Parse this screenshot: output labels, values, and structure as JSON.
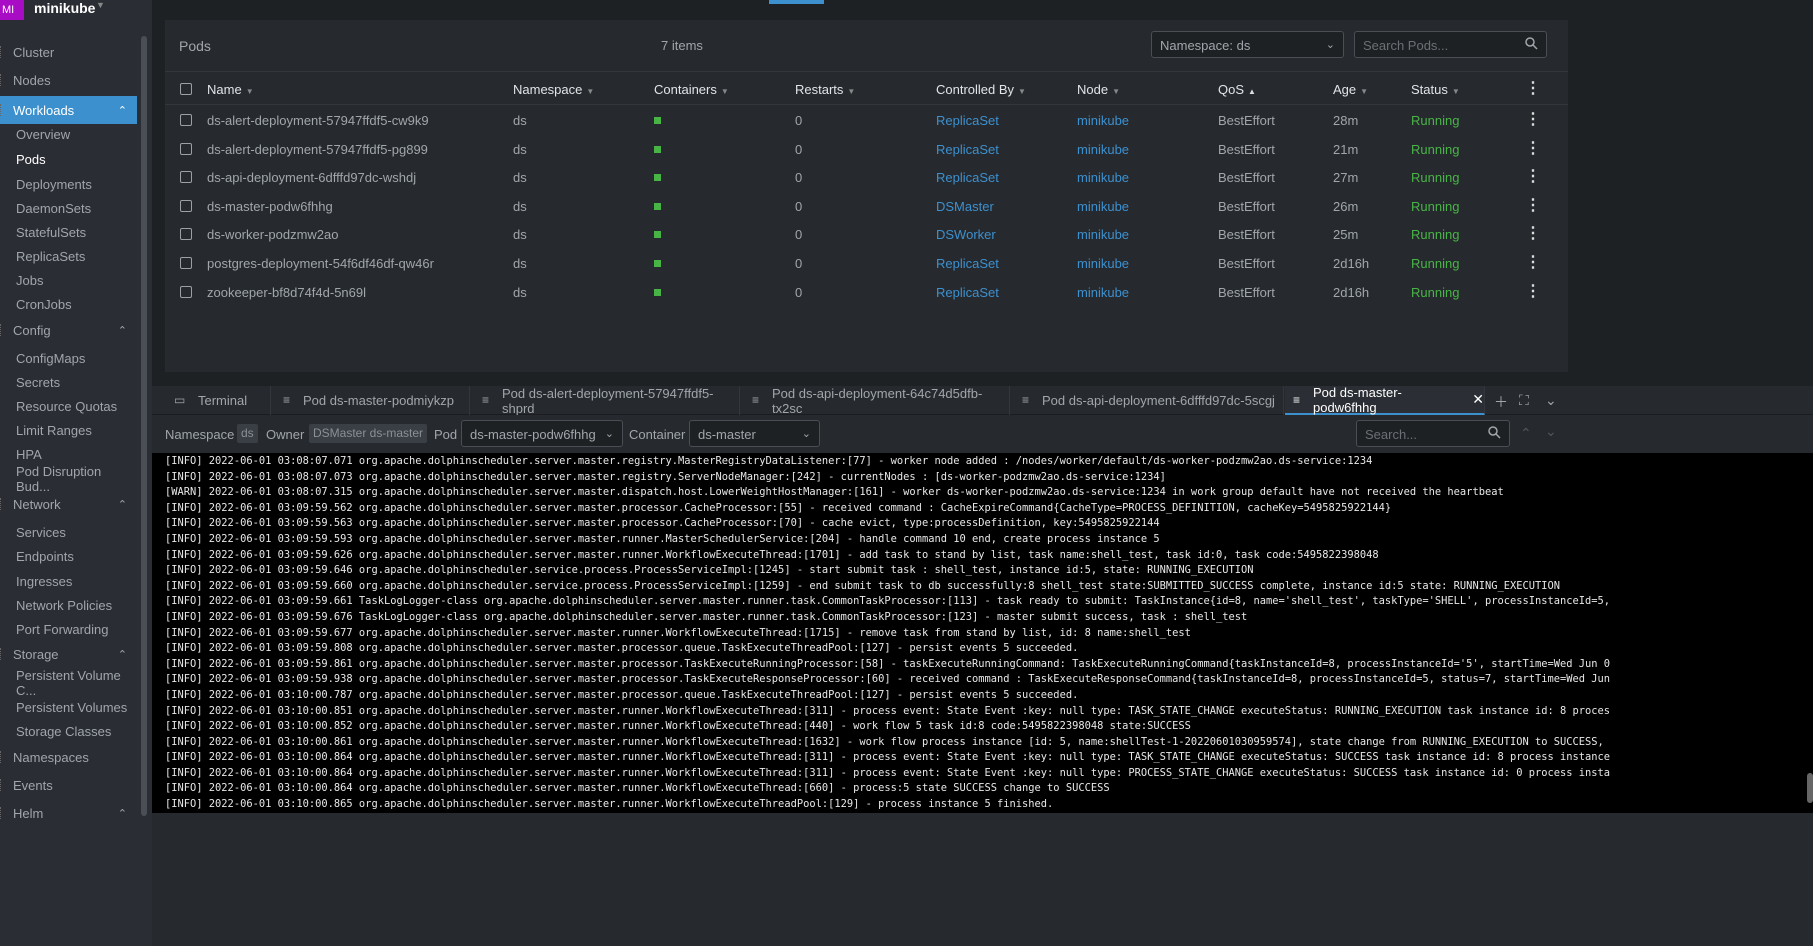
{
  "cluster": {
    "badge": "MI",
    "name": "minikube"
  },
  "sidebar": {
    "items": [
      {
        "label": "Cluster",
        "type": "top"
      },
      {
        "label": "Nodes",
        "type": "top"
      },
      {
        "label": "Workloads",
        "type": "top-active"
      },
      {
        "label": "Overview",
        "type": "sub"
      },
      {
        "label": "Pods",
        "type": "sub-active"
      },
      {
        "label": "Deployments",
        "type": "sub"
      },
      {
        "label": "DaemonSets",
        "type": "sub"
      },
      {
        "label": "StatefulSets",
        "type": "sub"
      },
      {
        "label": "ReplicaSets",
        "type": "sub"
      },
      {
        "label": "Jobs",
        "type": "sub"
      },
      {
        "label": "CronJobs",
        "type": "sub"
      },
      {
        "label": "Config",
        "type": "top-group"
      },
      {
        "label": "ConfigMaps",
        "type": "sub"
      },
      {
        "label": "Secrets",
        "type": "sub"
      },
      {
        "label": "Resource Quotas",
        "type": "sub"
      },
      {
        "label": "Limit Ranges",
        "type": "sub"
      },
      {
        "label": "HPA",
        "type": "sub"
      },
      {
        "label": "Pod Disruption Bud...",
        "type": "sub"
      },
      {
        "label": "Network",
        "type": "top-group"
      },
      {
        "label": "Services",
        "type": "sub"
      },
      {
        "label": "Endpoints",
        "type": "sub"
      },
      {
        "label": "Ingresses",
        "type": "sub"
      },
      {
        "label": "Network Policies",
        "type": "sub"
      },
      {
        "label": "Port Forwarding",
        "type": "sub"
      },
      {
        "label": "Storage",
        "type": "top-group"
      },
      {
        "label": "Persistent Volume C...",
        "type": "sub"
      },
      {
        "label": "Persistent Volumes",
        "type": "sub"
      },
      {
        "label": "Storage Classes",
        "type": "sub"
      },
      {
        "label": "Namespaces",
        "type": "top"
      },
      {
        "label": "Events",
        "type": "top"
      },
      {
        "label": "Helm",
        "type": "top-group"
      }
    ]
  },
  "pods": {
    "title": "Pods",
    "count": "7 items",
    "namespace_select": "Namespace: ds",
    "search_placeholder": "Search Pods...",
    "columns": [
      "Name",
      "Namespace",
      "Containers",
      "Restarts",
      "Controlled By",
      "Node",
      "QoS",
      "Age",
      "Status"
    ],
    "rows": [
      {
        "name": "ds-alert-deployment-57947ffdf5-cw9k9",
        "namespace": "ds",
        "restarts": "0",
        "controlled_by": "ReplicaSet",
        "node": "minikube",
        "qos": "BestEffort",
        "age": "28m",
        "status": "Running"
      },
      {
        "name": "ds-alert-deployment-57947ffdf5-pg899",
        "namespace": "ds",
        "restarts": "0",
        "controlled_by": "ReplicaSet",
        "node": "minikube",
        "qos": "BestEffort",
        "age": "21m",
        "status": "Running"
      },
      {
        "name": "ds-api-deployment-6dfffd97dc-wshdj",
        "namespace": "ds",
        "restarts": "0",
        "controlled_by": "ReplicaSet",
        "node": "minikube",
        "qos": "BestEffort",
        "age": "27m",
        "status": "Running"
      },
      {
        "name": "ds-master-podw6fhhg",
        "namespace": "ds",
        "restarts": "0",
        "controlled_by": "DSMaster",
        "node": "minikube",
        "qos": "BestEffort",
        "age": "26m",
        "status": "Running"
      },
      {
        "name": "ds-worker-podzmw2ao",
        "namespace": "ds",
        "restarts": "0",
        "controlled_by": "DSWorker",
        "node": "minikube",
        "qos": "BestEffort",
        "age": "25m",
        "status": "Running"
      },
      {
        "name": "postgres-deployment-54f6df46df-qw46r",
        "namespace": "ds",
        "restarts": "0",
        "controlled_by": "ReplicaSet",
        "node": "minikube",
        "qos": "BestEffort",
        "age": "2d16h",
        "status": "Running"
      },
      {
        "name": "zookeeper-bf8d74f4d-5n69l",
        "namespace": "ds",
        "restarts": "0",
        "controlled_by": "ReplicaSet",
        "node": "minikube",
        "qos": "BestEffort",
        "age": "2d16h",
        "status": "Running"
      }
    ]
  },
  "dock": {
    "tabs": [
      {
        "label": "Terminal",
        "icon": "terminal-icon"
      },
      {
        "label": "Pod ds-master-podmiykzp",
        "icon": "log-icon"
      },
      {
        "label": "Pod ds-alert-deployment-57947ffdf5-shprd",
        "icon": "log-icon"
      },
      {
        "label": "Pod ds-api-deployment-64c74d5dfb-tx2sc",
        "icon": "log-icon"
      },
      {
        "label": "Pod ds-api-deployment-6dfffd97dc-5scgj",
        "icon": "log-icon"
      },
      {
        "label": "Pod ds-master-podw6fhhg",
        "icon": "log-icon",
        "active": true
      }
    ],
    "namespace_label": "Namespace",
    "namespace_value": "ds",
    "owner_label": "Owner",
    "owner_value": "DSMaster ds-master",
    "pod_label": "Pod",
    "pod_select": "ds-master-podw6fhhg",
    "container_label": "Container",
    "container_select": "ds-master",
    "search_placeholder": "Search..."
  },
  "logs": [
    "[INFO] 2022-06-01 03:08:07.071 org.apache.dolphinscheduler.server.master.registry.MasterRegistryDataListener:[77] - worker node added : /nodes/worker/default/ds-worker-podzmw2ao.ds-service:1234",
    "[INFO] 2022-06-01 03:08:07.073 org.apache.dolphinscheduler.server.master.registry.ServerNodeManager:[242] - currentNodes : [ds-worker-podzmw2ao.ds-service:1234]",
    "[WARN] 2022-06-01 03:08:07.315 org.apache.dolphinscheduler.server.master.dispatch.host.LowerWeightHostManager:[161] - worker ds-worker-podzmw2ao.ds-service:1234 in work group default have not received the heartbeat",
    "[INFO] 2022-06-01 03:09:59.562 org.apache.dolphinscheduler.server.master.processor.CacheProcessor:[55] - received command : CacheExpireCommand{CacheType=PROCESS_DEFINITION, cacheKey=5495825922144}",
    "[INFO] 2022-06-01 03:09:59.563 org.apache.dolphinscheduler.server.master.processor.CacheProcessor:[70] - cache evict, type:processDefinition, key:5495825922144",
    "[INFO] 2022-06-01 03:09:59.593 org.apache.dolphinscheduler.server.master.runner.MasterSchedulerService:[204] - handle command 10 end, create process instance 5",
    "[INFO] 2022-06-01 03:09:59.626 org.apache.dolphinscheduler.server.master.runner.WorkflowExecuteThread:[1701] - add task to stand by list, task name:shell_test, task id:0, task code:5495822398048",
    "[INFO] 2022-06-01 03:09:59.646 org.apache.dolphinscheduler.service.process.ProcessServiceImpl:[1245] - start submit task : shell_test, instance id:5, state: RUNNING_EXECUTION",
    "[INFO] 2022-06-01 03:09:59.660 org.apache.dolphinscheduler.service.process.ProcessServiceImpl:[1259] - end submit task to db successfully:8 shell_test state:SUBMITTED_SUCCESS complete, instance id:5 state: RUNNING_EXECUTION",
    "[INFO] 2022-06-01 03:09:59.661 TaskLogLogger-class org.apache.dolphinscheduler.server.master.runner.task.CommonTaskProcessor:[113] - task ready to submit: TaskInstance{id=8, name='shell_test', taskType='SHELL', processInstanceId=5,",
    "[INFO] 2022-06-01 03:09:59.676 TaskLogLogger-class org.apache.dolphinscheduler.server.master.runner.task.CommonTaskProcessor:[123] - master submit success, task : shell_test",
    "[INFO] 2022-06-01 03:09:59.677 org.apache.dolphinscheduler.server.master.runner.WorkflowExecuteThread:[1715] - remove task from stand by list, id: 8 name:shell_test",
    "[INFO] 2022-06-01 03:09:59.808 org.apache.dolphinscheduler.server.master.processor.queue.TaskExecuteThreadPool:[127] - persist events 5 succeeded.",
    "[INFO] 2022-06-01 03:09:59.861 org.apache.dolphinscheduler.server.master.processor.TaskExecuteRunningProcessor:[58] - taskExecuteRunningCommand: TaskExecuteRunningCommand{taskInstanceId=8, processInstanceId='5', startTime=Wed Jun 0",
    "[INFO] 2022-06-01 03:09:59.938 org.apache.dolphinscheduler.server.master.processor.TaskExecuteResponseProcessor:[60] - received command : TaskExecuteResponseCommand{taskInstanceId=8, processInstanceId=5, status=7, startTime=Wed Jun",
    "[INFO] 2022-06-01 03:10:00.787 org.apache.dolphinscheduler.server.master.processor.queue.TaskExecuteThreadPool:[127] - persist events 5 succeeded.",
    "[INFO] 2022-06-01 03:10:00.851 org.apache.dolphinscheduler.server.master.runner.WorkflowExecuteThread:[311] - process event: State Event :key: null type: TASK_STATE_CHANGE executeStatus: RUNNING_EXECUTION task instance id: 8 proces",
    "[INFO] 2022-06-01 03:10:00.852 org.apache.dolphinscheduler.server.master.runner.WorkflowExecuteThread:[440] - work flow 5 task id:8 code:5495822398048 state:SUCCESS",
    "[INFO] 2022-06-01 03:10:00.861 org.apache.dolphinscheduler.server.master.runner.WorkflowExecuteThread:[1632] - work flow process instance [id: 5, name:shellTest-1-20220601030959574], state change from RUNNING_EXECUTION to SUCCESS,",
    "[INFO] 2022-06-01 03:10:00.864 org.apache.dolphinscheduler.server.master.runner.WorkflowExecuteThread:[311] - process event: State Event :key: null type: TASK_STATE_CHANGE executeStatus: SUCCESS task instance id: 8 process instance",
    "[INFO] 2022-06-01 03:10:00.864 org.apache.dolphinscheduler.server.master.runner.WorkflowExecuteThread:[311] - process event: State Event :key: null type: PROCESS_STATE_CHANGE executeStatus: SUCCESS task instance id: 0 process insta",
    "[INFO] 2022-06-01 03:10:00.864 org.apache.dolphinscheduler.server.master.runner.WorkflowExecuteThread:[660] - process:5 state SUCCESS change to SUCCESS",
    "[INFO] 2022-06-01 03:10:00.865 org.apache.dolphinscheduler.server.master.runner.WorkflowExecuteThreadPool:[129] - process instance 5 finished."
  ]
}
